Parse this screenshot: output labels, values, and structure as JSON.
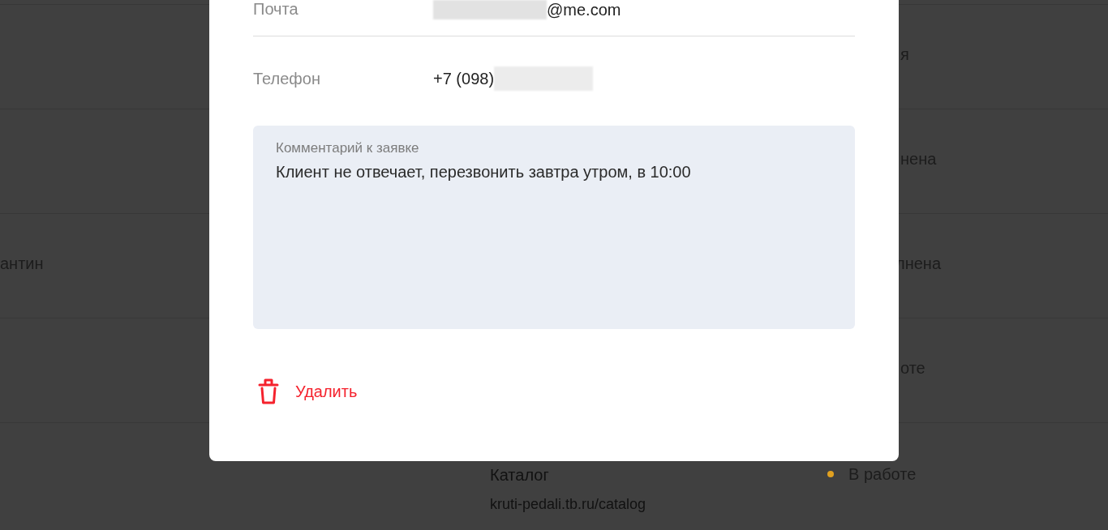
{
  "background_table": {
    "rows": [
      {
        "status": "я"
      },
      {
        "status": "нена"
      },
      {
        "name": "антин",
        "status": "лнена"
      },
      {
        "status": "оте"
      },
      {
        "page_title": "Каталог",
        "url": "kruti-pedali.tb.ru/catalog",
        "status": "В работе",
        "color": "#e0a020"
      }
    ]
  },
  "modal": {
    "fields": [
      {
        "label": "Почта",
        "value": "@me.com",
        "value_first": false
      },
      {
        "label": "Телефон",
        "value": "+7 (098)",
        "value_first": true
      }
    ],
    "comment": {
      "label": "Комментарий к заявке",
      "text": "Клиент не отвечает, перезвонить завтра утром, в 10:00"
    },
    "delete_button": "Удалить"
  }
}
